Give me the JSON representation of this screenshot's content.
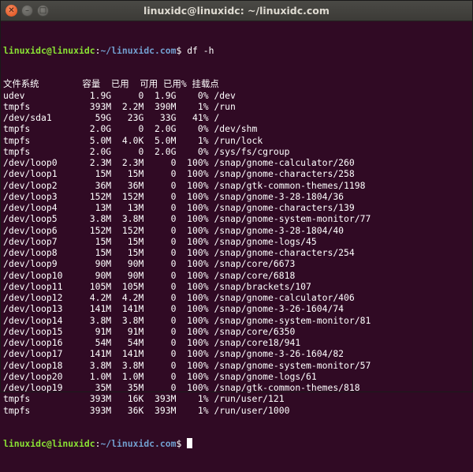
{
  "window": {
    "title": "linuxidc@linuxidc: ~/linuxidc.com"
  },
  "prompt": {
    "user_host": "linuxidc@linuxidc",
    "colon": ":",
    "path": "~/linuxidc.com",
    "symbol": "$ "
  },
  "command": "df -h",
  "output_lines": [
    "文件系统        容量  已用  可用 已用% 挂载点",
    "udev            1.9G     0  1.9G    0% /dev",
    "tmpfs           393M  2.2M  390M    1% /run",
    "/dev/sda1        59G   23G   33G   41% /",
    "tmpfs           2.0G     0  2.0G    0% /dev/shm",
    "tmpfs           5.0M  4.0K  5.0M    1% /run/lock",
    "tmpfs           2.0G     0  2.0G    0% /sys/fs/cgroup",
    "/dev/loop0      2.3M  2.3M     0  100% /snap/gnome-calculator/260",
    "/dev/loop1       15M   15M     0  100% /snap/gnome-characters/258",
    "/dev/loop2       36M   36M     0  100% /snap/gtk-common-themes/1198",
    "/dev/loop3      152M  152M     0  100% /snap/gnome-3-28-1804/36",
    "/dev/loop4       13M   13M     0  100% /snap/gnome-characters/139",
    "/dev/loop5      3.8M  3.8M     0  100% /snap/gnome-system-monitor/77",
    "/dev/loop6      152M  152M     0  100% /snap/gnome-3-28-1804/40",
    "/dev/loop7       15M   15M     0  100% /snap/gnome-logs/45",
    "/dev/loop8       15M   15M     0  100% /snap/gnome-characters/254",
    "/dev/loop9       90M   90M     0  100% /snap/core/6673",
    "/dev/loop10      90M   90M     0  100% /snap/core/6818",
    "/dev/loop11     105M  105M     0  100% /snap/brackets/107",
    "/dev/loop12     4.2M  4.2M     0  100% /snap/gnome-calculator/406",
    "/dev/loop13     141M  141M     0  100% /snap/gnome-3-26-1604/74",
    "/dev/loop14     3.8M  3.8M     0  100% /snap/gnome-system-monitor/81",
    "/dev/loop15      91M   91M     0  100% /snap/core/6350",
    "/dev/loop16      54M   54M     0  100% /snap/core18/941",
    "/dev/loop17     141M  141M     0  100% /snap/gnome-3-26-1604/82",
    "/dev/loop18     3.8M  3.8M     0  100% /snap/gnome-system-monitor/57",
    "/dev/loop20     1.0M  1.0M     0  100% /snap/gnome-logs/61",
    "/dev/loop19      35M   35M     0  100% /snap/gtk-common-themes/818",
    "tmpfs           393M   16K  393M    1% /run/user/121",
    "tmpfs           393M   36K  393M    1% /run/user/1000"
  ]
}
